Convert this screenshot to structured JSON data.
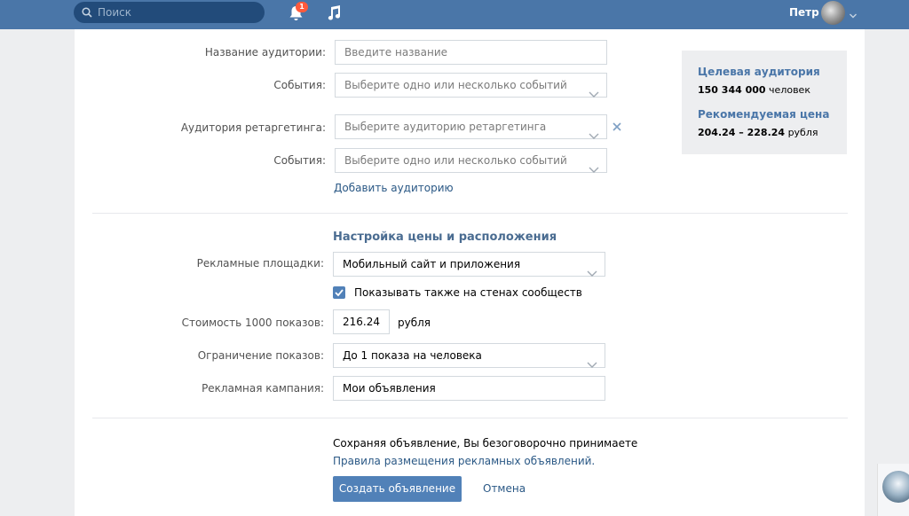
{
  "topbar": {
    "search_placeholder": "Поиск",
    "notifications_count": "1",
    "user_name": "Петр"
  },
  "audience": {
    "name_label": "Название аудитории:",
    "name_placeholder": "Введите название",
    "events_label": "События:",
    "events_placeholder": "Выберите одно или несколько событий",
    "retarget_label": "Аудитория ретаргетинга:",
    "retarget_placeholder": "Выберите аудиторию ретаргетинга",
    "events2_label": "События:",
    "events2_placeholder": "Выберите одно или несколько событий",
    "add_audience_link": "Добавить аудиторию"
  },
  "pricing": {
    "section_title": "Настройка цены и расположения",
    "platforms_label": "Рекламные площадки:",
    "platforms_value": "Мобильный сайт и приложения",
    "show_on_walls_label": "Показывать также на стенах сообществ",
    "show_on_walls_checked": true,
    "cost_label": "Стоимость 1000 показов:",
    "cost_value": "216.24",
    "cost_unit": "рубля",
    "limit_label": "Ограничение показов:",
    "limit_value": "До 1 показа на человека",
    "campaign_label": "Рекламная кампания:",
    "campaign_value": "Мои объявления"
  },
  "footer": {
    "agreement_text": "Сохраняя объявление, Вы безоговорочно принимаете",
    "rules_link": "Правила размещения рекламных объявлений.",
    "create_button": "Создать объявление",
    "cancel_button": "Отмена"
  },
  "aside": {
    "target_title": "Целевая аудитория",
    "target_count": "150 344 000",
    "target_unit": "человек",
    "price_title": "Рекомендуемая цена",
    "price_range": "204.24 – 228.24",
    "price_unit": "рубля"
  },
  "colors": {
    "header": "#4a76a8",
    "accent": "#5181b8",
    "link": "#2a5885",
    "badge": "#ff5a3c"
  }
}
